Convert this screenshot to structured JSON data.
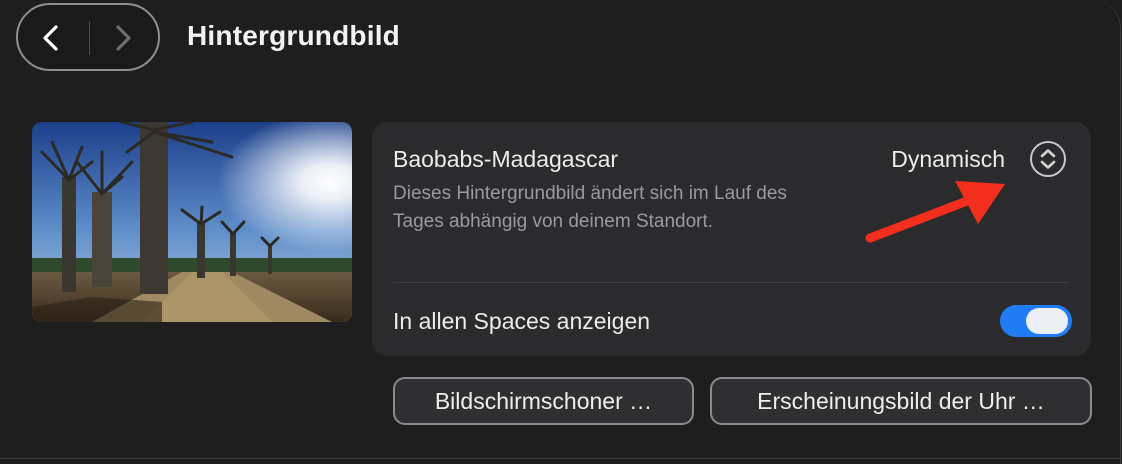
{
  "header": {
    "title": "Hintergrundbild",
    "back_icon": "chevron-left-icon",
    "forward_icon": "chevron-right-icon"
  },
  "wallpaper": {
    "name": "Baobabs-Madagascar",
    "description": "Dieses Hintergrundbild ändert sich im Lauf des Tages abhängig von deinem Standort.",
    "mode": "Dynamisch",
    "stepper_icon": "up-down-chevron-icon"
  },
  "spaces": {
    "label": "In allen Spaces anzeigen",
    "enabled": true
  },
  "buttons": {
    "screensaver": "Bildschirmschoner …",
    "clock_appearance": "Erscheinungsbild der Uhr …"
  },
  "annotation": {
    "arrow_icon": "red-arrow-icon",
    "arrow_color": "#f22e1d"
  },
  "colors": {
    "accent": "#1f7cf5",
    "background": "#1e1e1f",
    "card": "#2b2b2d"
  }
}
